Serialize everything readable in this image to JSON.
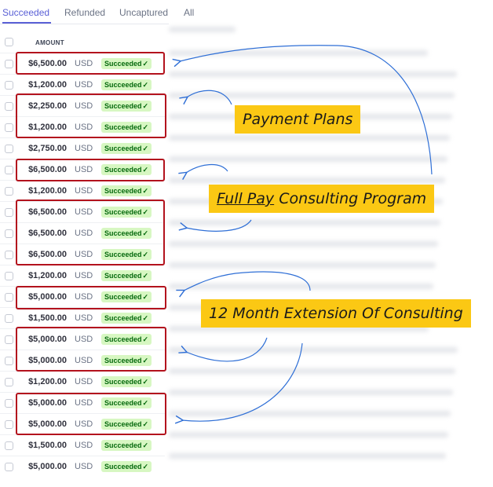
{
  "tabs": [
    {
      "label": "Succeeded",
      "active": true
    },
    {
      "label": "Refunded",
      "active": false
    },
    {
      "label": "Uncaptured",
      "active": false
    },
    {
      "label": "All",
      "active": false
    }
  ],
  "table": {
    "amount_header": "AMOUNT",
    "rows": [
      {
        "amount": "$6,500.00",
        "currency": "USD",
        "status": "Succeeded"
      },
      {
        "amount": "$1,200.00",
        "currency": "USD",
        "status": "Succeeded"
      },
      {
        "amount": "$2,250.00",
        "currency": "USD",
        "status": "Succeeded"
      },
      {
        "amount": "$1,200.00",
        "currency": "USD",
        "status": "Succeeded"
      },
      {
        "amount": "$2,750.00",
        "currency": "USD",
        "status": "Succeeded"
      },
      {
        "amount": "$6,500.00",
        "currency": "USD",
        "status": "Succeeded"
      },
      {
        "amount": "$1,200.00",
        "currency": "USD",
        "status": "Succeeded"
      },
      {
        "amount": "$6,500.00",
        "currency": "USD",
        "status": "Succeeded"
      },
      {
        "amount": "$6,500.00",
        "currency": "USD",
        "status": "Succeeded"
      },
      {
        "amount": "$6,500.00",
        "currency": "USD",
        "status": "Succeeded"
      },
      {
        "amount": "$1,200.00",
        "currency": "USD",
        "status": "Succeeded"
      },
      {
        "amount": "$5,000.00",
        "currency": "USD",
        "status": "Succeeded"
      },
      {
        "amount": "$1,500.00",
        "currency": "USD",
        "status": "Succeeded"
      },
      {
        "amount": "$5,000.00",
        "currency": "USD",
        "status": "Succeeded"
      },
      {
        "amount": "$5,000.00",
        "currency": "USD",
        "status": "Succeeded"
      },
      {
        "amount": "$1,200.00",
        "currency": "USD",
        "status": "Succeeded"
      },
      {
        "amount": "$5,000.00",
        "currency": "USD",
        "status": "Succeeded"
      },
      {
        "amount": "$5,000.00",
        "currency": "USD",
        "status": "Succeeded"
      },
      {
        "amount": "$1,500.00",
        "currency": "USD",
        "status": "Succeeded"
      },
      {
        "amount": "$5,000.00",
        "currency": "USD",
        "status": "Succeeded"
      }
    ]
  },
  "annotations": {
    "payment_plans": "Payment Plans",
    "full_pay_word": "Full Pay",
    "full_pay_rest": " Consulting Program",
    "extension": "12 Month Extension Of Consulting"
  },
  "colors": {
    "accent": "#5b61d6",
    "highlight_box": "#b3121d",
    "callout_bg": "#fbc814",
    "arrow": "#2f6fd6",
    "badge_bg": "#d7f7c2",
    "badge_text": "#05690d"
  },
  "icons": {
    "status_check": "checkmark-icon"
  }
}
